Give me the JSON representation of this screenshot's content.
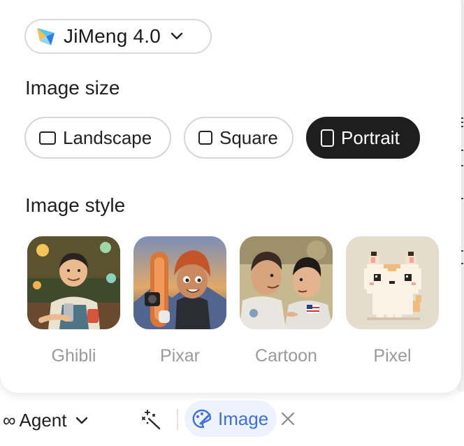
{
  "model": {
    "name": "JiMeng 4.0",
    "logo_icon": "jimeng-logo-icon"
  },
  "image_size": {
    "title": "Image size",
    "options": [
      {
        "label": "Landscape",
        "selected": false
      },
      {
        "label": "Square",
        "selected": false
      },
      {
        "label": "Portrait",
        "selected": true
      }
    ]
  },
  "image_style": {
    "title": "Image style",
    "options": [
      {
        "label": "Ghibli"
      },
      {
        "label": "Pixar"
      },
      {
        "label": "Cartoon"
      },
      {
        "label": "Pixel"
      }
    ]
  },
  "bottom_bar": {
    "agent_label": "Agent",
    "image_label": "Image"
  },
  "colors": {
    "selected_bg": "#1e1e1e",
    "accent_blue": "#3d6fe0",
    "chip_bg": "#eef2fd",
    "muted_text": "#9a9a9a"
  }
}
